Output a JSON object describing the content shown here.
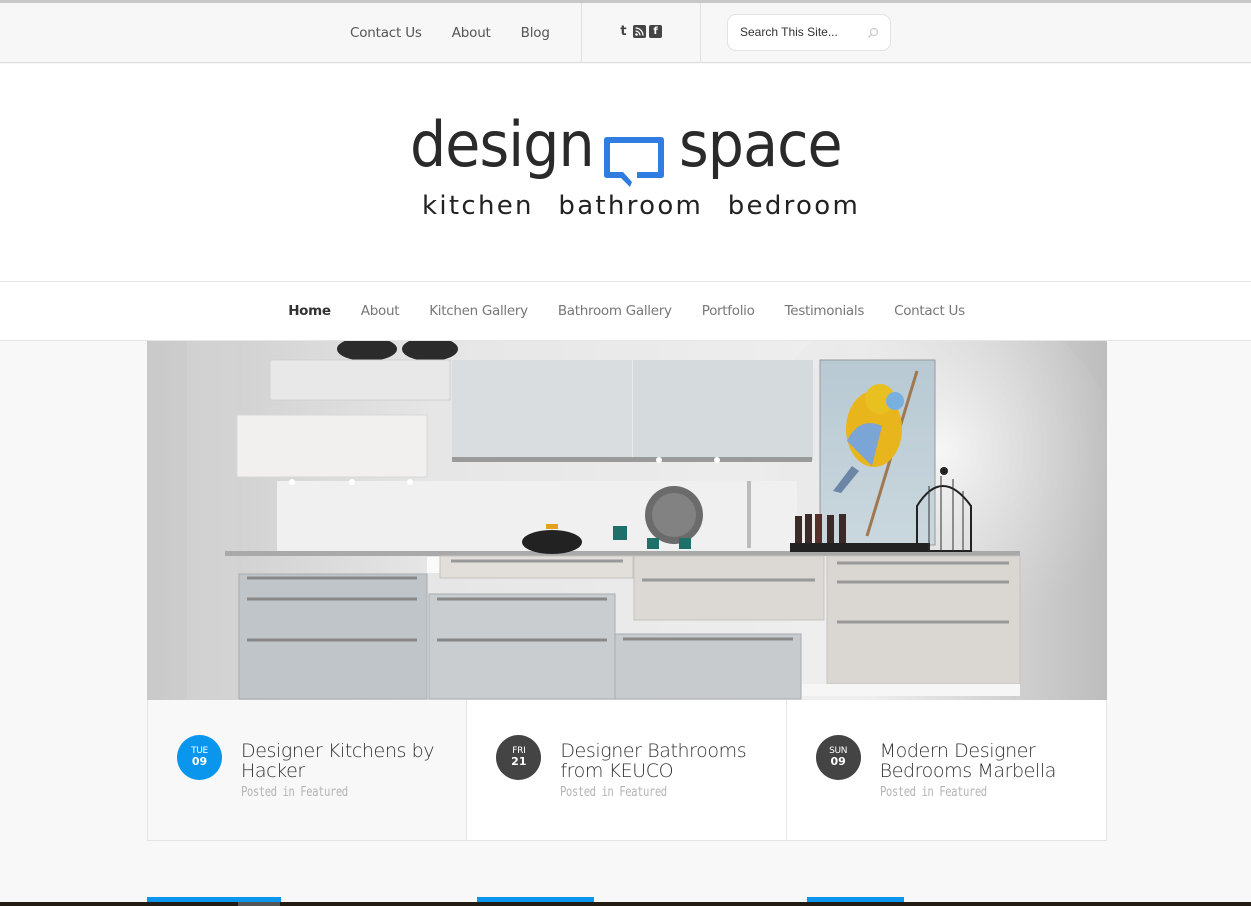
{
  "topbar": {
    "links": [
      "Contact Us",
      "About",
      "Blog"
    ],
    "social_icons": [
      "twitter-icon",
      "rss-icon",
      "facebook-icon"
    ],
    "search": {
      "placeholder": "Search This Site...",
      "value": ""
    }
  },
  "logo": {
    "word_left": "design",
    "word_right": "space",
    "tagline": "kitchen bathroom bedroom",
    "accent_color": "#2f7de1"
  },
  "nav": {
    "items": [
      {
        "label": "Home",
        "active": true
      },
      {
        "label": "About",
        "active": false
      },
      {
        "label": "Kitchen Gallery",
        "active": false
      },
      {
        "label": "Bathroom Gallery",
        "active": false
      },
      {
        "label": "Portfolio",
        "active": false
      },
      {
        "label": "Testimonials",
        "active": false
      },
      {
        "label": "Contact Us",
        "active": false
      }
    ]
  },
  "hero": {
    "alt": "Modern kitchen with white and grey cabinets and a bird painting"
  },
  "posts": [
    {
      "day": "TUE",
      "date": "09",
      "title": "Designer Kitchens by Hacker",
      "meta": "Posted in Featured",
      "badge_color": "#0a96ec",
      "active": true
    },
    {
      "day": "FRI",
      "date": "21",
      "title": "Designer Bathrooms from KEUCO",
      "meta": "Posted in Featured",
      "badge_color": "#444444",
      "active": false
    },
    {
      "day": "SUN",
      "date": "09",
      "title": "Modern Designer Bedrooms Marbella",
      "meta": "Posted in Featured",
      "badge_color": "#444444",
      "active": false
    }
  ],
  "colors": {
    "accent": "#0a96ec",
    "text": "#333333",
    "muted": "#b5b5b5"
  }
}
